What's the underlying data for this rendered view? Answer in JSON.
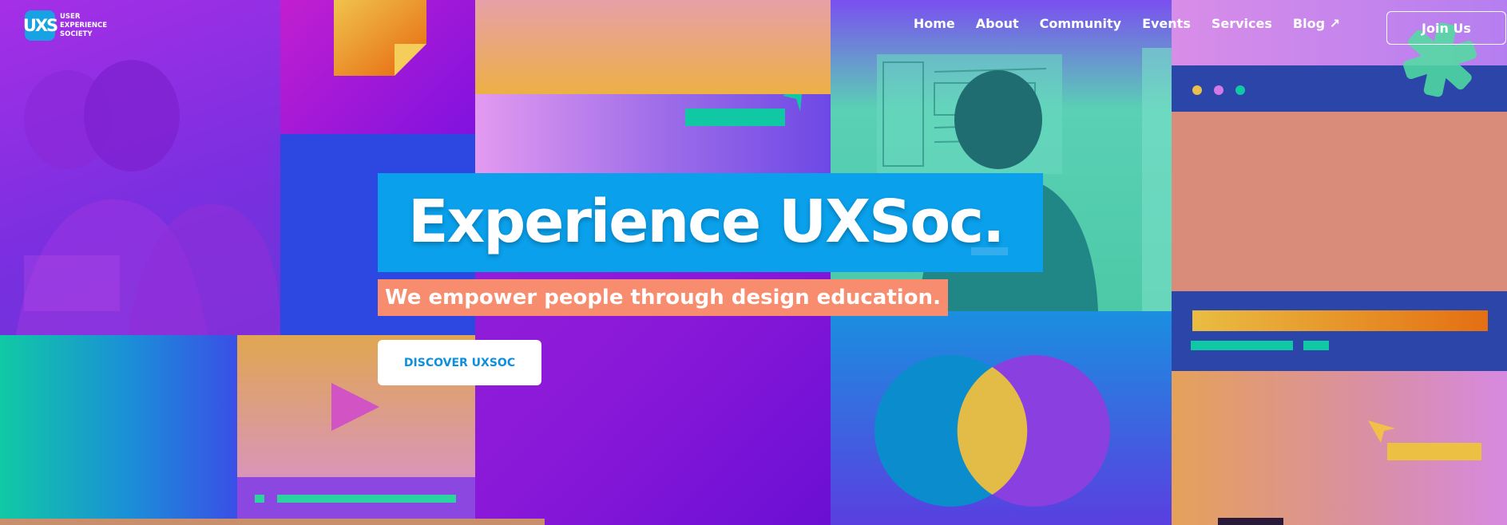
{
  "brand": {
    "logo_mark": "UXS",
    "name_line1": "USER",
    "name_line2": "EXPERIENCE",
    "name_line3": "SOCIETY"
  },
  "nav": {
    "items": [
      {
        "label": "Home"
      },
      {
        "label": "About"
      },
      {
        "label": "Community"
      },
      {
        "label": "Events"
      },
      {
        "label": "Services"
      },
      {
        "label": "Blog ↗"
      }
    ],
    "join_label": "Join Us"
  },
  "hero": {
    "title": "Experience UXSoc.",
    "subtitle": "We empower people through design education.",
    "cta_label": "DISCOVER UXSOC"
  },
  "colors": {
    "accent_blue": "#0aa0ec",
    "accent_coral": "#f88c6e",
    "accent_teal": "#10c9a4",
    "accent_yellow": "#e8c04a",
    "accent_purple": "#8a2be2"
  }
}
